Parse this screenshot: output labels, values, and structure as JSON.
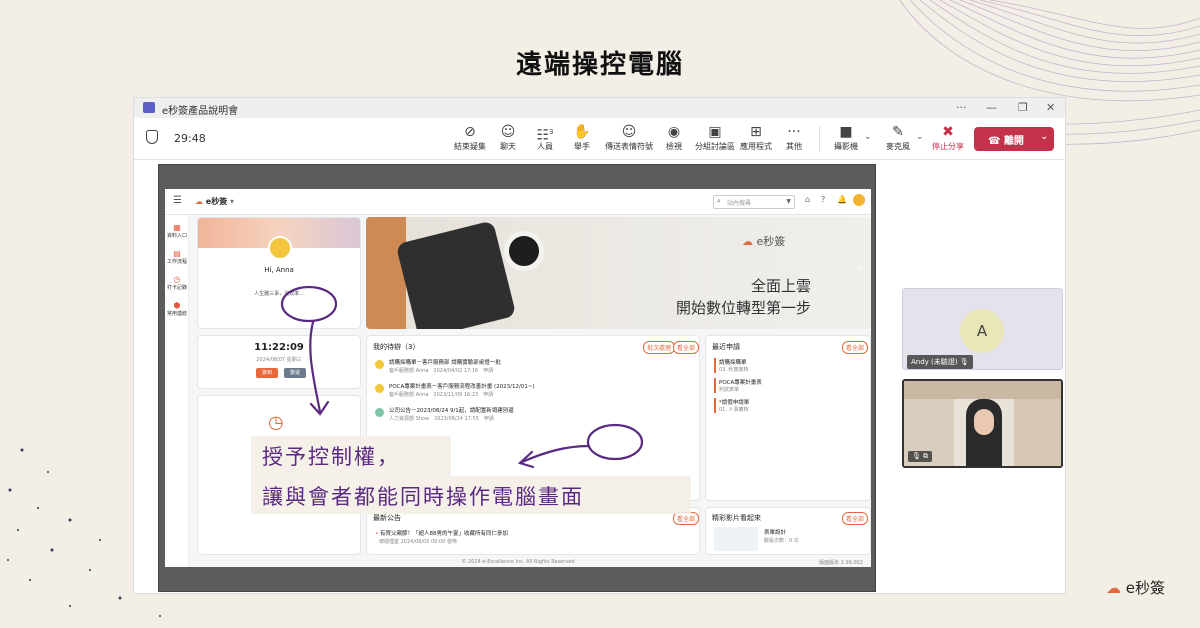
{
  "page_title": "遠端操控電腦",
  "window": {
    "title": "e秒簽產品說明會",
    "more": "···",
    "min": "—",
    "restore": "❐",
    "close": "✕"
  },
  "meeting": {
    "elapsed": "29:48",
    "tools": [
      {
        "icon": "⊘",
        "label": "結束疑集"
      },
      {
        "icon": "☺",
        "label": "聊天"
      },
      {
        "icon": "☷",
        "label": "人員"
      },
      {
        "icon": "✋",
        "label": "舉手"
      },
      {
        "icon": "☺",
        "label": "傳送表情符號"
      },
      {
        "icon": "◉",
        "label": "檢視"
      },
      {
        "icon": "▣",
        "label": "分組討論區"
      },
      {
        "icon": "⊞",
        "label": "應用程式"
      },
      {
        "icon": "···",
        "label": "其他"
      },
      {
        "icon": "■",
        "label": "攝影機"
      },
      {
        "icon": "✎",
        "label": "麥克風"
      },
      {
        "icon": "✖",
        "label": "停止分享"
      }
    ],
    "people_count": "3",
    "leave_label": "離開"
  },
  "app": {
    "search_placeholder": "站內搜尋",
    "sidebar": [
      "資料入口",
      "工作流程",
      "打卡記錄",
      "常用連結"
    ],
    "user": {
      "greeting": "Hi, Anna",
      "status": "人生難三事，沒效率..."
    },
    "clock": {
      "time": "11:22:09",
      "date": "2024/08/07 星期三",
      "btn1": "簽到",
      "btn2": "簽退"
    },
    "banner": {
      "brand": "e秒簽",
      "line1": "全面上雲",
      "line2": "開始數位轉型第一步"
    },
    "todo": {
      "title": "我的待辦（3）",
      "btn1": "批次處理",
      "btn2": "看全部",
      "items": [
        {
          "title": "請購採購單－客戶服務部 請購實驗部桌燈一批",
          "meta": "客戶服務部 Anna　2024/04/02 17:16　申請"
        },
        {
          "title": "POCA專案計畫表－客戶服務流程改善計畫 (2023/12/01~)",
          "meta": "客戶服務部 Anna　2023/11/09 16:23　申請"
        },
        {
          "title": "公司公告－2023/08/24 9/1起，請配置新領建別還",
          "meta": "人力資源部 Show　2023/08/24 17:55　申請"
        }
      ]
    },
    "recent": {
      "title": "最近申請",
      "btn": "看全部",
      "items": [
        {
          "title": "請購採購單",
          "sub": "03. 秒簽簽核"
        },
        {
          "title": "POCA專案計畫表",
          "sub": "判試表單"
        },
        {
          "title": "*請假申請單",
          "sub": "01. 人事審核"
        }
      ]
    },
    "news": {
      "title": "最新公告",
      "btn": "看全部",
      "item": "有賀父親節！「超人88男的午宴」收藏所有同仁參加",
      "meta": "總經理室 2024/08/05 09:00 發佈"
    },
    "video_card": {
      "title": "精彩影片看起來",
      "btn": "看全部",
      "item": "表單設計",
      "meta": "觀看次數：0 次"
    },
    "footer": "© 2024 e-Excellence Inc. All Rights Reserved",
    "version": "版面版本 2.99.002"
  },
  "annotation": {
    "line1": "授予控制權，",
    "line2": "讓與會者都能同時操作電腦畫面"
  },
  "participants": {
    "a_initial": "A",
    "a_name": "Andy (未驗證)"
  },
  "brand_logo": "e秒簽",
  "colors": {
    "accent": "#e06a3b",
    "annotation": "#5a2a82",
    "leave": "#c4314b"
  }
}
